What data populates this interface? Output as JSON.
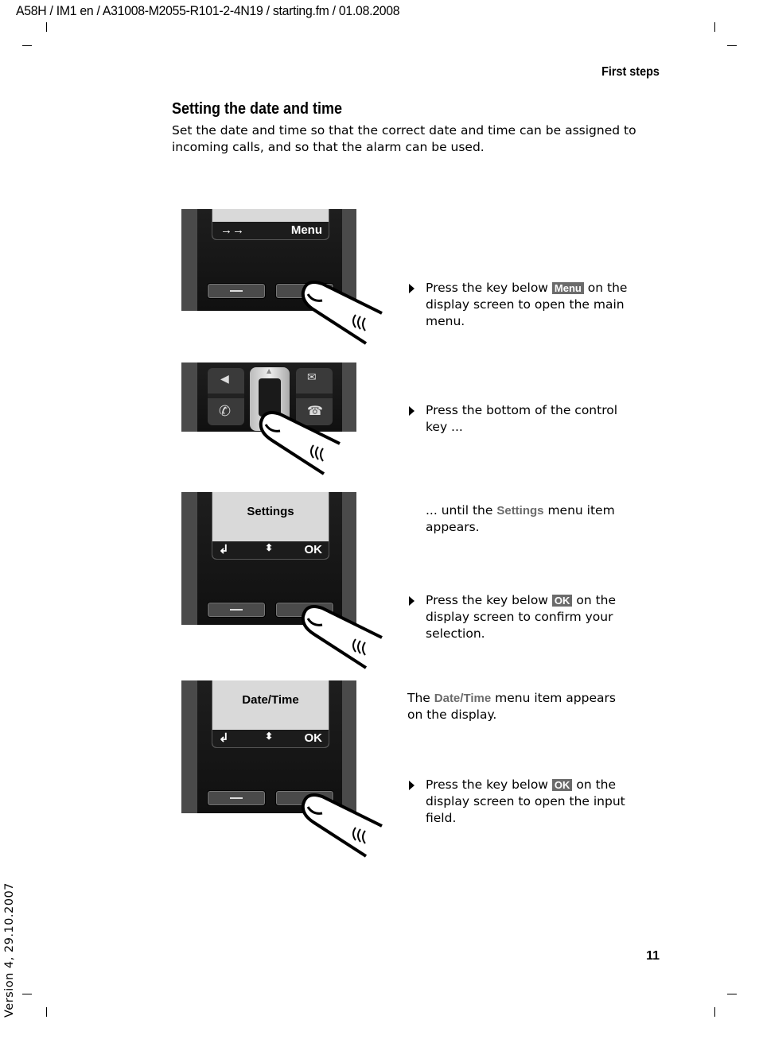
{
  "doc_header": "A58H / IM1 en / A31008-M2055-R101-2-4N19 / starting.fm / 01.08.2008",
  "section_header": "First steps",
  "title": "Setting the date and time",
  "intro": "Set the date and time so that the correct date and time can be assigned to incoming calls, and so that the alarm can be used.",
  "figures": [
    {
      "screen_left": "→→",
      "screen_right": "Menu"
    },
    {
      "keypad": [
        "speaker-key",
        "talk-key",
        "control-key",
        "message-key",
        "end-call-key"
      ]
    },
    {
      "menu_item": "Settings",
      "left": "back",
      "middle": "up-down",
      "right": "OK"
    },
    {
      "menu_item": "Date/Time",
      "left": "back",
      "middle": "up-down",
      "right": "OK"
    }
  ],
  "steps": [
    {
      "pre": "Press the key below ",
      "key": "Menu",
      "post": " on the display screen to open the main menu."
    },
    {
      "text": "Press the bottom of the control key ..."
    },
    {
      "pre": "... until the ",
      "hl": "Settings",
      "post": " menu item appears."
    },
    {
      "pre": "Press the key below ",
      "key": "OK",
      "post": " on the display screen to confirm your selection."
    },
    {
      "pre": "The ",
      "hl": "Date/Time",
      "post": " menu item appears on the display."
    },
    {
      "pre": "Press the key below ",
      "key": "OK",
      "post": " on the display screen to open the input field."
    }
  ],
  "version": "Version 4, 29.10.2007",
  "page_number": "11",
  "colors": {
    "key_bg": "#6b6b6b",
    "highlight": "#6b6b6b"
  }
}
